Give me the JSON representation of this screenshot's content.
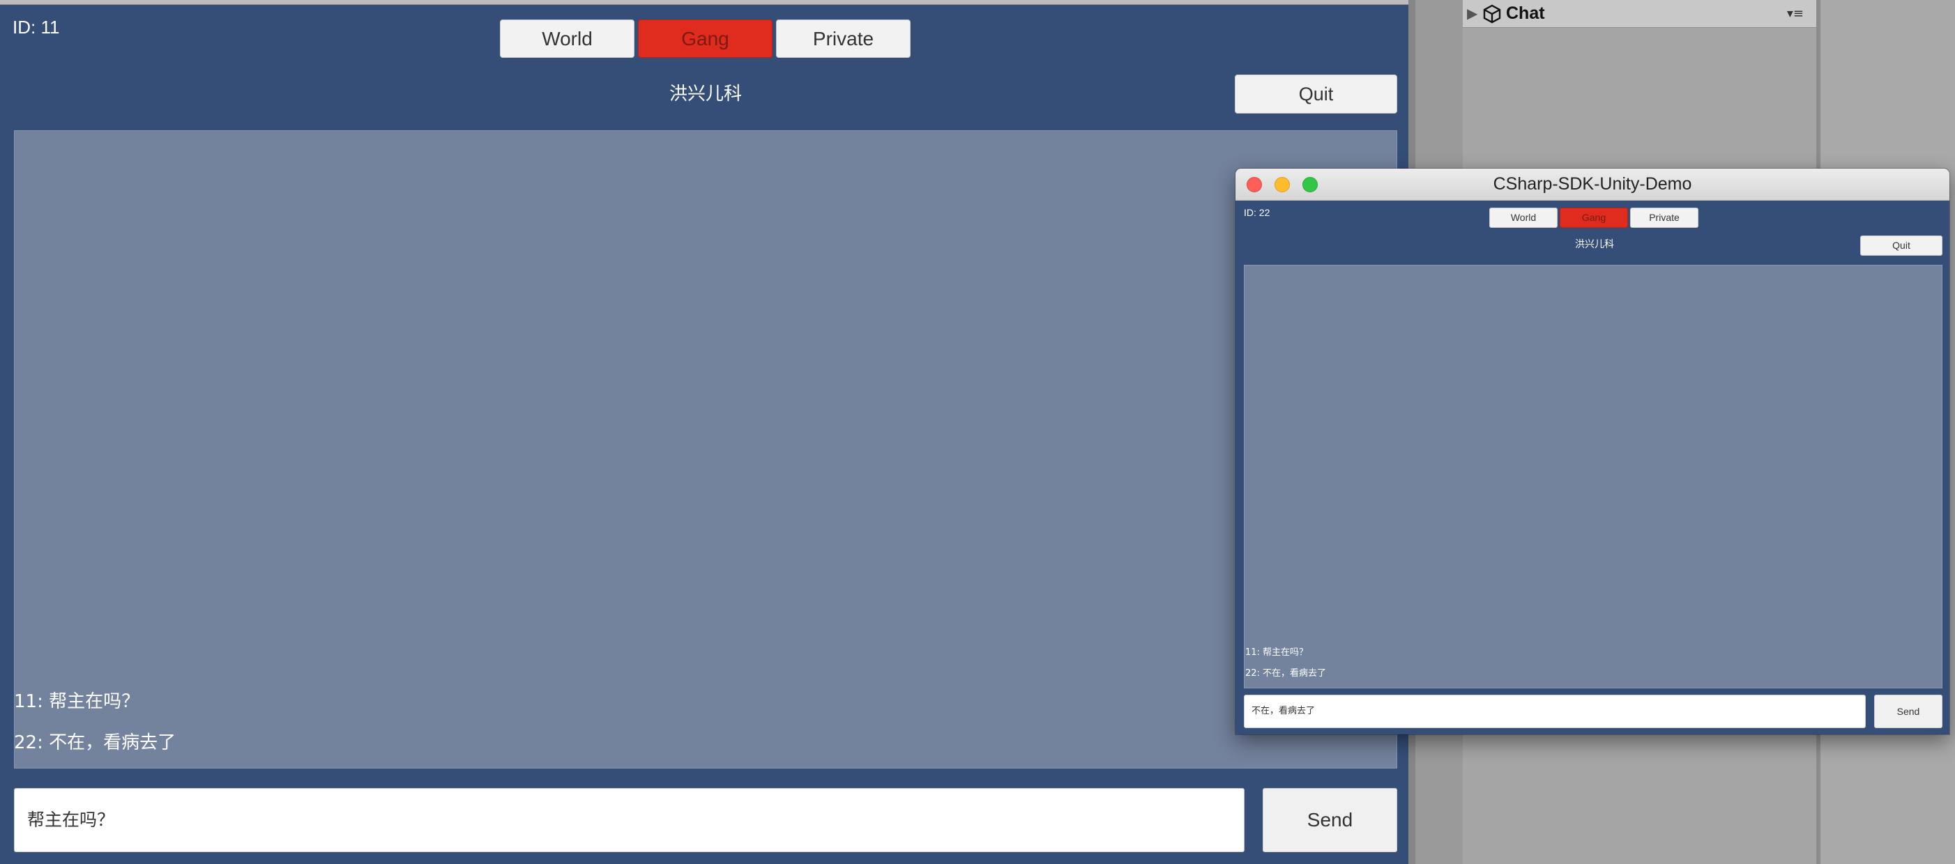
{
  "main_client": {
    "id_label": "ID: 11",
    "tabs": [
      {
        "label": "World"
      },
      {
        "label": "Gang"
      },
      {
        "label": "Private"
      }
    ],
    "channel_name": "洪兴儿科",
    "quit_label": "Quit",
    "messages": [
      "11: 帮主在吗？",
      "22: 不在，看病去了"
    ],
    "input_value": "帮主在吗？",
    "send_label": "Send"
  },
  "hierarchy": {
    "item_label": "Chat",
    "icon": "unity-logo-icon",
    "menu_icon": "dropdown-menu-icon"
  },
  "second_window": {
    "title": "CSharp-SDK-Unity-Demo",
    "id_label": "ID: 22",
    "tabs": [
      {
        "label": "World"
      },
      {
        "label": "Gang"
      },
      {
        "label": "Private"
      }
    ],
    "channel_name": "洪兴儿科",
    "quit_label": "Quit",
    "messages": [
      "11: 帮主在吗？",
      "22: 不在，看病去了"
    ],
    "input_value": "不在，看病去了",
    "send_label": "Send"
  },
  "colors": {
    "background_blue": "#354e78",
    "panel_gray_blue": "#73829d",
    "active_tab_red": "#e02b1f",
    "button_white": "#f2f2f2"
  }
}
